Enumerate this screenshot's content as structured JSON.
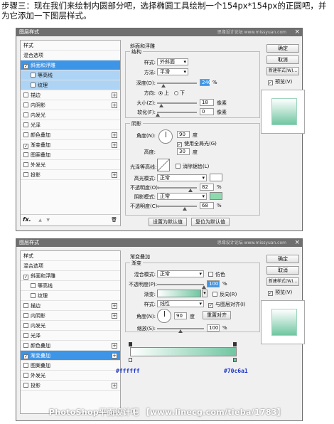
{
  "header_text": "步骤三：现在我们来绘制内圆部分吧，选择椭圆工具绘制一个154px*154px的正圆吧，并为它添加一下图层样式。",
  "dialog_title": "图层样式",
  "watermark": "思缘设计论坛 www.missyuan.com",
  "close_glyph": "×",
  "side_title": "样式",
  "side_blend": "混合选项",
  "side_items": [
    "斜面和浮雕",
    "等高线",
    "纹理",
    "描边",
    "内阴影",
    "内发光",
    "光泽",
    "颜色叠加",
    "渐变叠加",
    "图案叠加",
    "外发光",
    "投影"
  ],
  "check_mark": "✓",
  "fx_label": "fx.",
  "up_arrow": "▲",
  "down_arrow": "▼",
  "trash_glyph": "🗑",
  "buttons": {
    "ok": "确定",
    "cancel": "取消",
    "new_style": "新建样式(W)...",
    "preview": "预览(V)",
    "set_default": "设置为默认值",
    "reset_default": "复位为默认值",
    "reverse_align": "重置对齐"
  },
  "bevel": {
    "group_title": "斜面和浮雕",
    "struct_title": "结构",
    "style_label": "样式:",
    "style_value": "外斜面",
    "method_label": "方法:",
    "method_value": "平滑",
    "depth_label": "深度(D):",
    "depth_value": "240",
    "pct": "%",
    "direction_label": "方向:",
    "dir_up": "上",
    "dir_down": "下",
    "size_label": "大小(Z):",
    "size_value": "18",
    "px": "像素",
    "soften_label": "软化(F):",
    "soften_value": "0",
    "shading_title": "阴影",
    "angle_label": "角度(N):",
    "angle_value": "90",
    "degree": "度",
    "global_light": "使用全局光(G)",
    "altitude_label": "高度:",
    "altitude_value": "30",
    "gloss_label": "光泽等高线:",
    "anti_alias": "消除锯齿(L)",
    "hl_mode_label": "高光模式:",
    "hl_mode_value": "正常",
    "hl_opacity_label": "不透明度(O):",
    "hl_opacity_value": "82",
    "shadow_mode_label": "阴影模式:",
    "shadow_mode_value": "正常",
    "shadow_opacity_label": "不透明度(C):",
    "shadow_opacity_value": "68",
    "hl_color": "#ffffff",
    "shadow_color": "#8ed9ae"
  },
  "gradient": {
    "group_title": "渐变叠加",
    "sub_title": "渐变",
    "blend_label": "混合模式:",
    "blend_value": "正常",
    "dither": "仿色",
    "opacity_label": "不透明度(P):",
    "opacity_value": "100",
    "gradient_label": "渐变:",
    "reverse": "反向(R)",
    "style_label": "样式:",
    "style_value": "线性",
    "align": "与图层对齐(I)",
    "angle_label": "角度(N):",
    "angle_value": "90",
    "scale_label": "缩放(S):",
    "scale_value": "100",
    "start_color": "#ffffff",
    "end_color": "#70c6a1",
    "start_hex": "#ffffff",
    "end_hex": "#70c6a1"
  },
  "caption": "PhotoShop平面设计吧 【www.linecg.com/tieba/1783】"
}
